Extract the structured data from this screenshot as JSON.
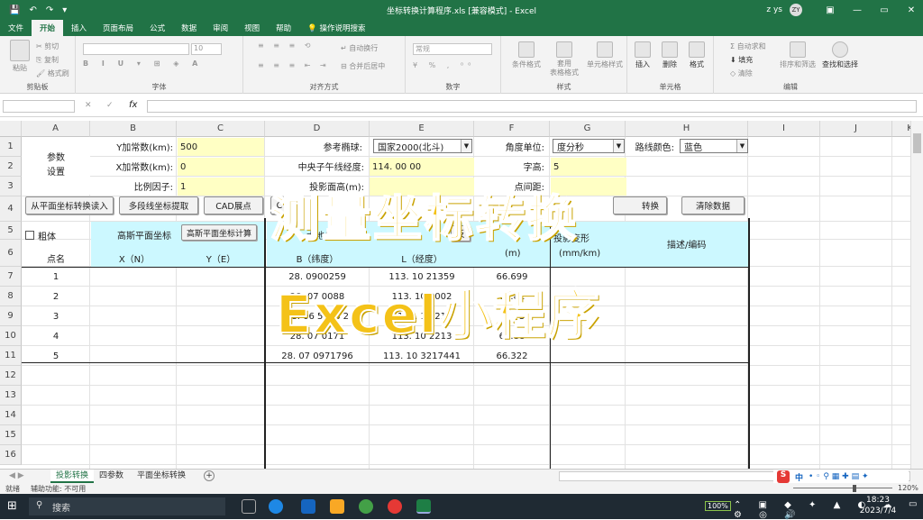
{
  "window": {
    "title": "坐标转换计算程序.xls  [兼容模式]  -  Excel",
    "user": "z ys",
    "avatar": "ZY",
    "minimize": "—",
    "restore": "▭",
    "close": "✕",
    "ribbon_toggle": "▣"
  },
  "menu": {
    "file": "文件",
    "home": "开始",
    "insert": "插入",
    "layout": "页面布局",
    "formulas": "公式",
    "data": "数据",
    "review": "审阅",
    "view": "视图",
    "help": "帮助",
    "tell": "操作说明搜索"
  },
  "ribbon": {
    "groups": {
      "clipboard": "剪贴板",
      "font": "字体",
      "align": "对齐方式",
      "number": "数字",
      "styles": "样式",
      "cells": "单元格",
      "editing": "编辑"
    },
    "paste": "粘贴",
    "cut": "剪切",
    "copy": "复制",
    "format_painter": "格式刷",
    "wrap": "自动换行",
    "merge": "合并后居中",
    "number_format": "常规",
    "font_size": "10",
    "cond_format": "条件格式",
    "table_format": "套用\n表格格式",
    "cell_style": "单元格样式",
    "insert": "插入",
    "delete": "删除",
    "format": "格式",
    "autosum": "自动求和",
    "fill": "填充",
    "clear": "清除",
    "sort": "排序和筛选",
    "find": "查找和选择"
  },
  "formula_bar": {
    "fx": "fx",
    "cancel": "✕",
    "enter": "✓"
  },
  "columns": [
    "A",
    "B",
    "C",
    "D",
    "E",
    "F",
    "G",
    "H",
    "I",
    "J",
    "K"
  ],
  "rows": [
    "1",
    "2",
    "3",
    "4",
    "5",
    "6",
    "7",
    "8",
    "9",
    "10",
    "11",
    "12",
    "13",
    "14",
    "15",
    "16"
  ],
  "params": {
    "title": "参数\n设置",
    "y_const_label": "Y加常数(km):",
    "y_const": "500",
    "x_const_label": "X加常数(km):",
    "x_const": "0",
    "scale_label": "比例因子:",
    "scale": "1",
    "ellipsoid_label": "参考椭球:",
    "ellipsoid": "国家2000(北斗)",
    "meridian_label": "中央子午线经度:",
    "meridian": "114. 00 00",
    "height_label": "投影面高(m):",
    "angle_label": "角度单位:",
    "angle": "度分秒",
    "font_label": "字高:",
    "font_value": "5",
    "spacing_label": "点间距:",
    "color_label": "路线颜色:",
    "color": "蓝色"
  },
  "buttons": {
    "read_plane": "从平面坐标转换读入",
    "polyline": "多段线坐标提取",
    "cad": "CAD展点",
    "c": "C",
    "convert": "转换",
    "clear": "清除数据",
    "gauss_calc": "高斯平面坐标计算",
    "fan": "反"
  },
  "headers": {
    "bold": "粗体",
    "gauss_plane": "高斯平面坐标",
    "geodetic": "大地坐标",
    "elev": "(m)",
    "proj_deform": "投影变形",
    "proj_unit": "(mm/km)",
    "desc": "描述/编码",
    "point": "点名",
    "x": "X（N）",
    "y": "Y（E）",
    "b": "B（纬度）",
    "l": "L（经度）"
  },
  "table_rows": [
    {
      "name": "1",
      "b": "28. 0900259",
      "l": "113. 10 21359",
      "h": "66.699"
    },
    {
      "name": "2",
      "b": "28. 07 0088",
      "l": "113. 10 2002",
      "h": "63.81"
    },
    {
      "name": "3",
      "b": "28. 06 5438 2",
      "l": "113. 10 21",
      "h": "69.75"
    },
    {
      "name": "4",
      "b": "28. 07 0171",
      "l": "113. 10 2213",
      "h": "64.88"
    },
    {
      "name": "5",
      "b": "28. 07 0971796",
      "l": "113. 10 3217441",
      "h": "66.322"
    }
  ],
  "overlay": {
    "line1": "测量坐标转换",
    "line2": "Excel小程序"
  },
  "sheets": {
    "tab1": "投影转换",
    "tab2": "四参数",
    "tab3": "平面坐标转换",
    "add": "+"
  },
  "status": {
    "ready": "就绪",
    "access": "辅助功能: 不可用",
    "zoom": "120%"
  },
  "taskbar": {
    "search": "搜索",
    "battery": "100%",
    "ime": "中",
    "time": "18:23",
    "date": "2023/7/4"
  }
}
